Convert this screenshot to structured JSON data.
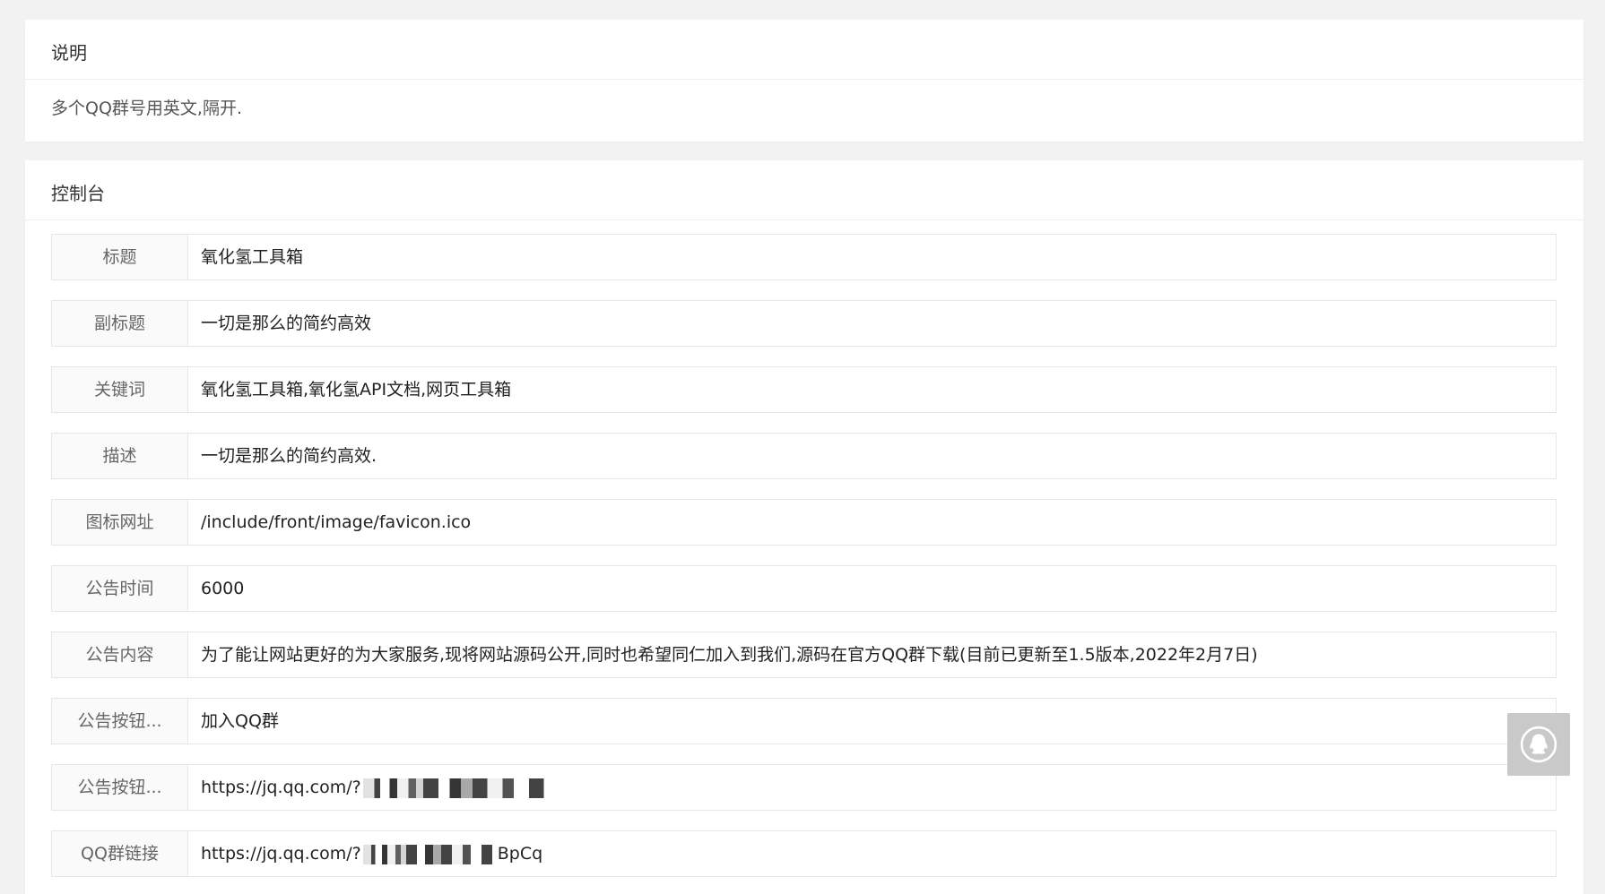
{
  "note": {
    "title": "说明",
    "body": "多个QQ群号用英文,隔开."
  },
  "console": {
    "title": "控制台",
    "fields": [
      {
        "label": "标题",
        "value": "氧化氢工具箱"
      },
      {
        "label": "副标题",
        "value": "一切是那么的简约高效"
      },
      {
        "label": "关键词",
        "value": "氧化氢工具箱,氧化氢API文档,网页工具箱"
      },
      {
        "label": "描述",
        "value": "一切是那么的简约高效."
      },
      {
        "label": "图标网址",
        "value": "/include/front/image/favicon.ico"
      },
      {
        "label": "公告时间",
        "value": "6000"
      },
      {
        "label": "公告内容",
        "value": "为了能让网站更好的为大家服务,现将网站源码公开,同时也希望同仁加入到我们,源码在官方QQ群下载(目前已更新至1.5版本,2022年2月7日)"
      },
      {
        "label": "公告按钮...",
        "value": "加入QQ群"
      },
      {
        "label": "公告按钮...",
        "value": "https://jq.qq.com/?"
      },
      {
        "label": "QQ群链接",
        "value": "https://jq.qq.com/?",
        "suffix": "BpCq"
      }
    ]
  },
  "float_button": {
    "icon": "qq-penguin-icon",
    "color": "#c9c9c9"
  }
}
